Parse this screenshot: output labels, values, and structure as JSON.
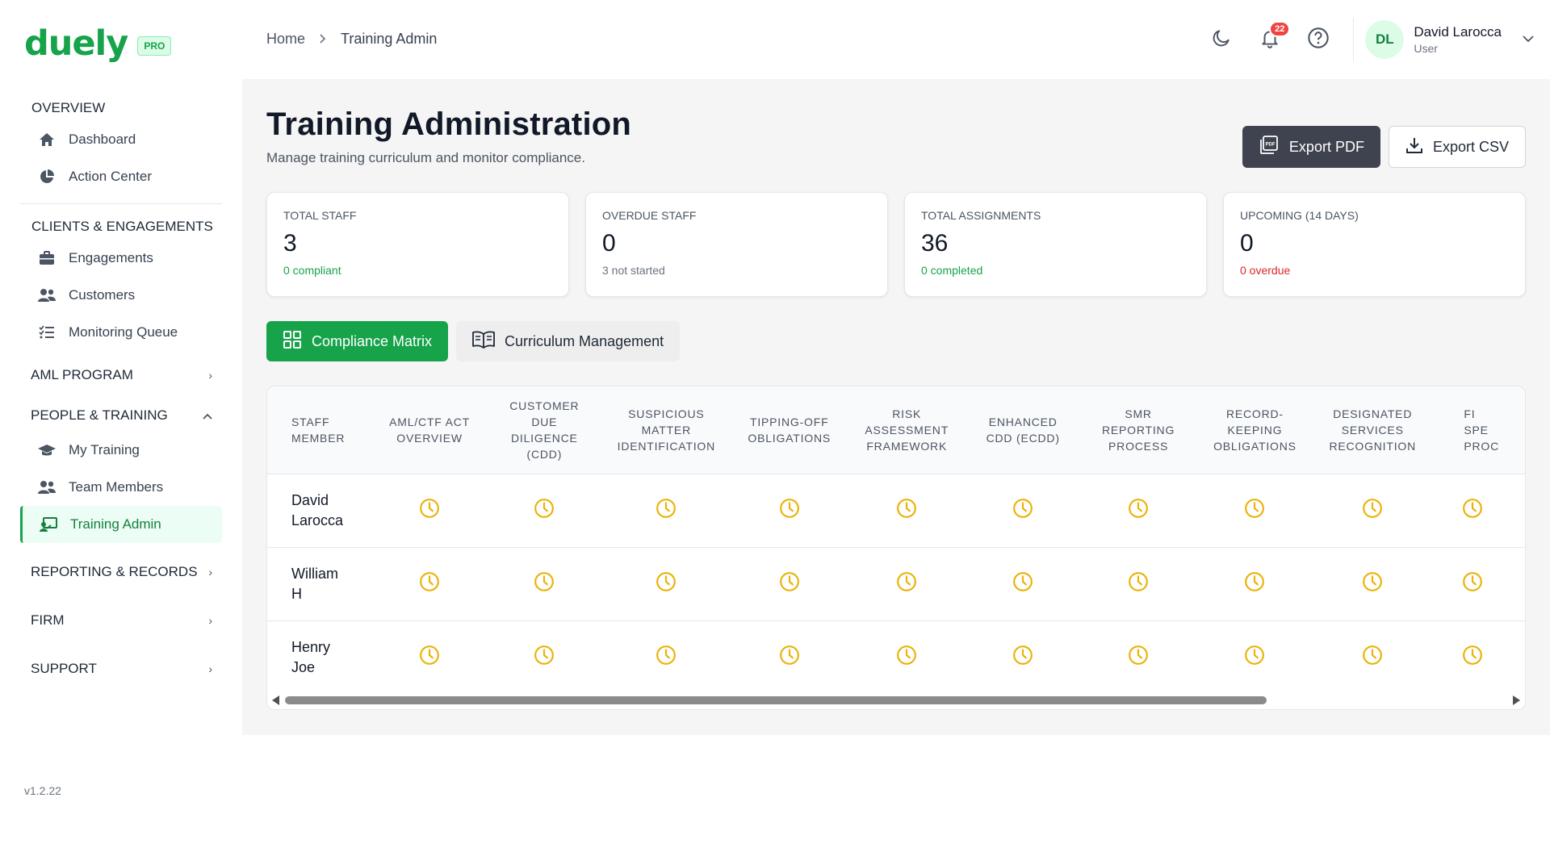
{
  "brand": {
    "name": "duely",
    "badge": "PRO",
    "accent": "#16a34a"
  },
  "version": "v1.2.22",
  "sidebar": {
    "overview": {
      "title": "OVERVIEW",
      "items": [
        {
          "label": "Dashboard",
          "icon": "home-icon"
        },
        {
          "label": "Action Center",
          "icon": "pie-chart-icon"
        }
      ]
    },
    "clients": {
      "title": "CLIENTS & ENGAGEMENTS",
      "items": [
        {
          "label": "Engagements",
          "icon": "briefcase-icon"
        },
        {
          "label": "Customers",
          "icon": "users-icon"
        },
        {
          "label": "Monitoring Queue",
          "icon": "list-check-icon"
        }
      ]
    },
    "aml": {
      "title": "AML PROGRAM"
    },
    "people": {
      "title": "PEOPLE & TRAINING",
      "items": [
        {
          "label": "My Training",
          "icon": "graduation-cap-icon"
        },
        {
          "label": "Team Members",
          "icon": "users-icon"
        },
        {
          "label": "Training Admin",
          "icon": "chalkboard-teacher-icon"
        }
      ]
    },
    "reporting": {
      "title": "REPORTING & RECORDS"
    },
    "firm": {
      "title": "FIRM"
    },
    "support": {
      "title": "SUPPORT"
    }
  },
  "breadcrumb": {
    "home": "Home",
    "current": "Training Admin"
  },
  "topbar": {
    "notifications": "22",
    "user": {
      "initials": "DL",
      "name": "David Larocca",
      "role": "User"
    }
  },
  "page": {
    "title": "Training Administration",
    "subtitle": "Manage training curriculum and monitor compliance.",
    "export_pdf": "Export PDF",
    "export_csv": "Export CSV"
  },
  "stats": [
    {
      "label": "TOTAL STAFF",
      "value": "3",
      "sub": "0 compliant",
      "sub_color": "#16a34a"
    },
    {
      "label": "OVERDUE STAFF",
      "value": "0",
      "sub": "3 not started",
      "sub_color": "#6b7280"
    },
    {
      "label": "TOTAL ASSIGNMENTS",
      "value": "36",
      "sub": "0 completed",
      "sub_color": "#16a34a"
    },
    {
      "label": "UPCOMING (14 DAYS)",
      "value": "0",
      "sub": "0 overdue",
      "sub_color": "#dc2626"
    }
  ],
  "tabs": {
    "matrix": "Compliance Matrix",
    "curriculum": "Curriculum Management"
  },
  "matrix": {
    "staff_header": [
      "STAFF",
      "MEMBER"
    ],
    "columns": [
      [
        "AML/CTF ACT",
        "OVERVIEW"
      ],
      [
        "CUSTOMER",
        "DUE",
        "DILIGENCE",
        "(CDD)"
      ],
      [
        "SUSPICIOUS",
        "MATTER",
        "IDENTIFICATION"
      ],
      [
        "TIPPING-OFF",
        "OBLIGATIONS"
      ],
      [
        "RISK",
        "ASSESSMENT",
        "FRAMEWORK"
      ],
      [
        "ENHANCED",
        "CDD (ECDD)"
      ],
      [
        "SMR",
        "REPORTING",
        "PROCESS"
      ],
      [
        "RECORD-",
        "KEEPING",
        "OBLIGATIONS"
      ],
      [
        "DESIGNATED",
        "SERVICES",
        "RECOGNITION"
      ],
      [
        "FI",
        "SPE",
        "PROC"
      ]
    ],
    "rows": [
      {
        "name": [
          "David",
          "Larocca"
        ],
        "status": "pending"
      },
      {
        "name": [
          "William",
          "H"
        ],
        "status": "pending"
      },
      {
        "name": [
          "Henry",
          "Joe"
        ],
        "status": "pending"
      }
    ],
    "status_color": "#eab308"
  }
}
